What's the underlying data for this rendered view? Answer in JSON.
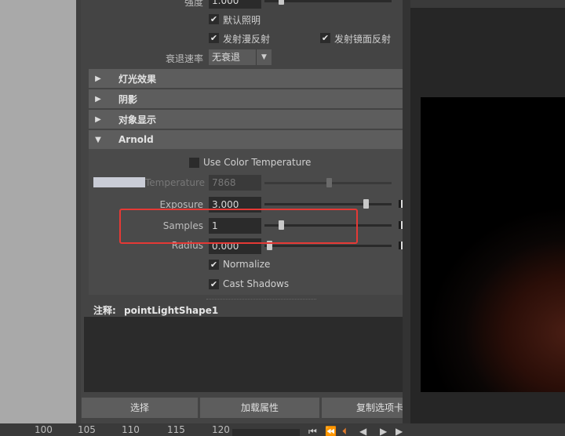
{
  "light_attrs": {
    "intensity_label": "强度",
    "intensity_value": "1.000",
    "illuminates_default_label": "默认照明",
    "emit_diffuse_label": "发射漫反射",
    "emit_specular_label": "发射镜面反射",
    "decay_rate_label": "衰退速率",
    "decay_rate_value": "无衰退"
  },
  "sections": {
    "light_effects": "灯光效果",
    "shadows": "阴影",
    "object_display": "对象显示",
    "arnold": "Arnold"
  },
  "arnold": {
    "use_color_temperature_label": "Use Color Temperature",
    "temperature_label": "Temperature",
    "temperature_value": "7868",
    "temperature_slider_fraction": 0.35,
    "exposure_label": "Exposure",
    "exposure_value": "3.000",
    "exposure_slider_fraction": 0.78,
    "samples_label": "Samples",
    "samples_value": "1",
    "samples_slider_fraction": 0.12,
    "radius_label": "Radius",
    "radius_value": "0.000",
    "radius_slider_fraction": 0.0,
    "normalize_label": "Normalize",
    "cast_shadows_label": "Cast Shadows",
    "temperature_swatch_color": "#c9ccd6"
  },
  "notes": {
    "label": "注释:",
    "node_name": "pointLightShape1"
  },
  "buttons": {
    "select": "选择",
    "load_attributes": "加载属性",
    "copy_tab": "复制选项卡"
  },
  "timeline": {
    "ticks": [
      "100",
      "105",
      "110",
      "115",
      "120"
    ]
  },
  "colors": {
    "highlight_box": "#e53935",
    "panel_bg": "#444444",
    "section_header": "#5d5d5d"
  }
}
